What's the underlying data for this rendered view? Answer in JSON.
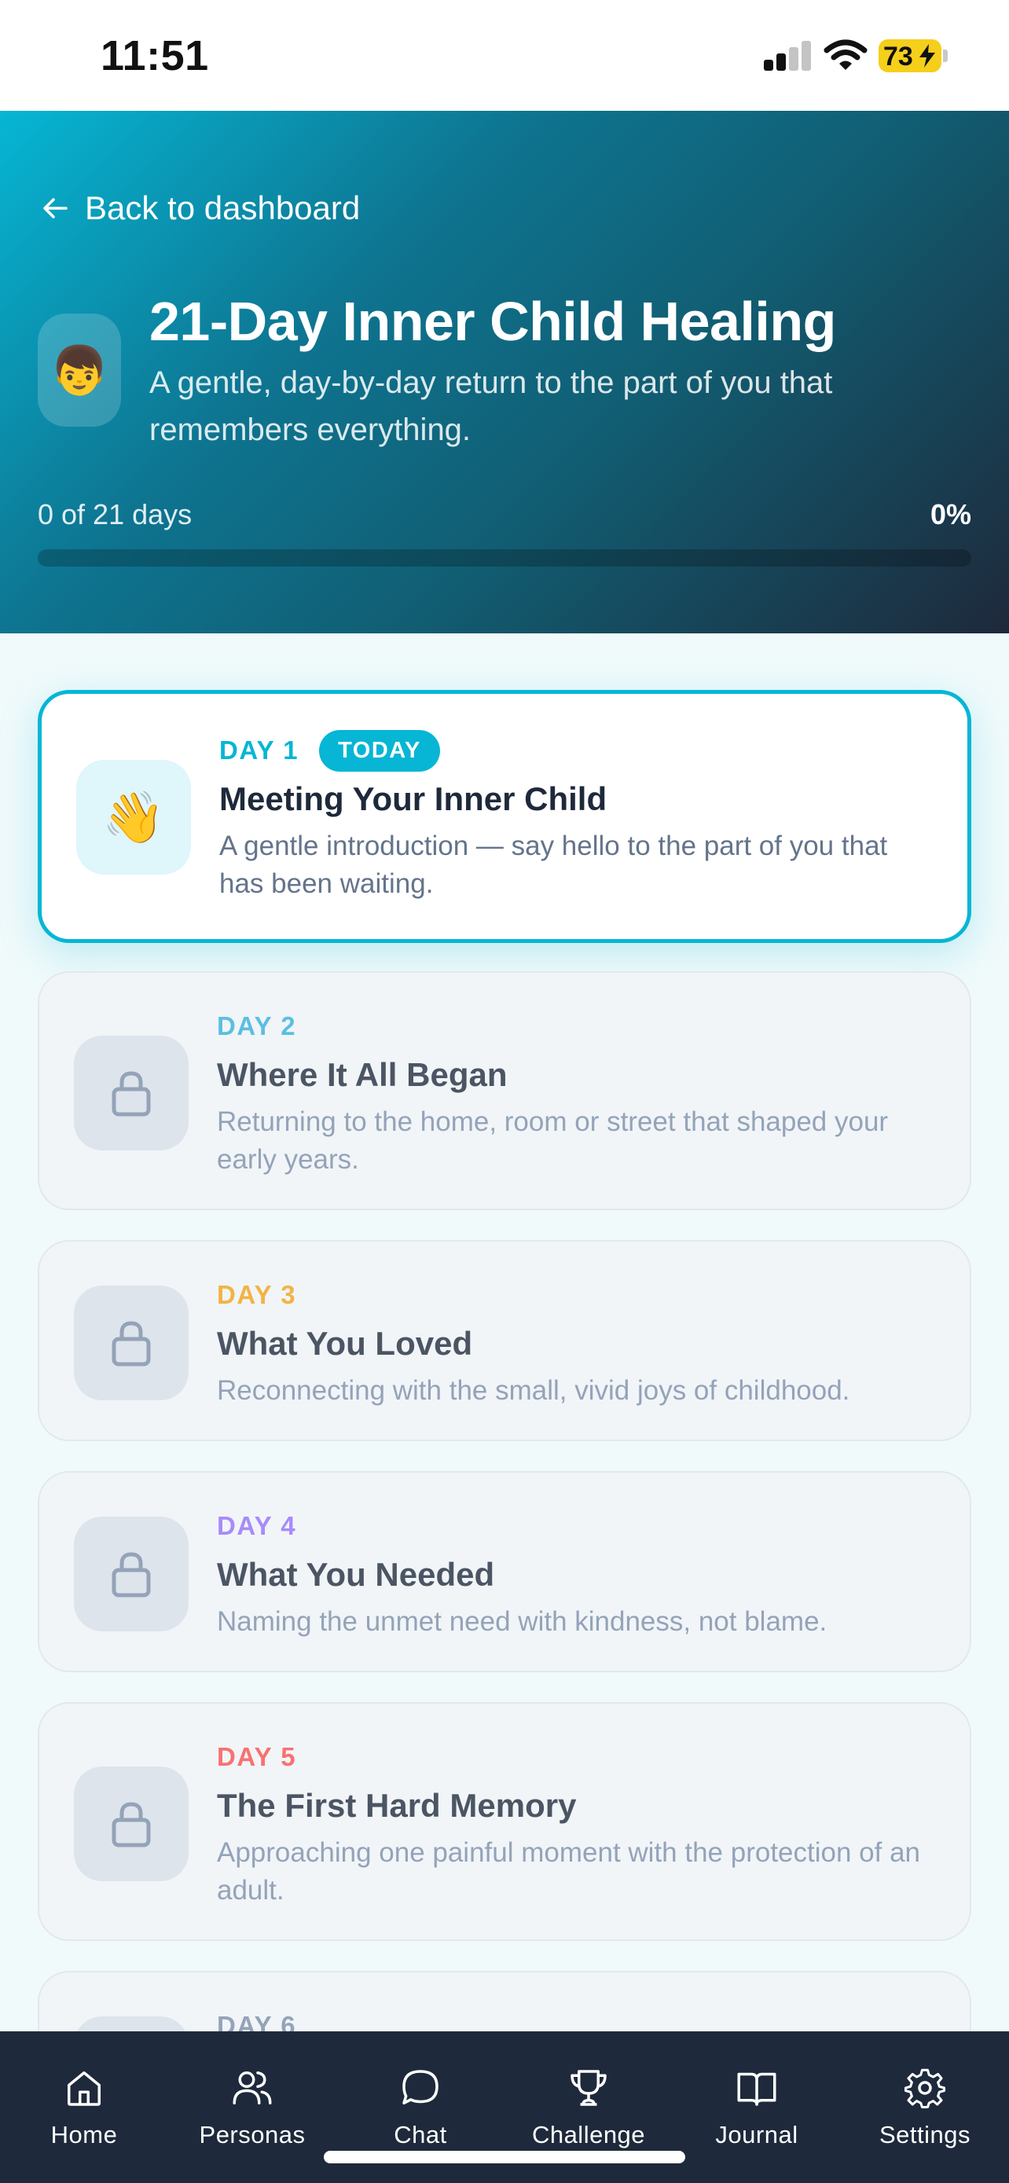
{
  "status_bar": {
    "time": "11:51",
    "battery": "73"
  },
  "header": {
    "back_label": "Back to dashboard",
    "hero_emoji": "👦",
    "title": "21-Day Inner Child Healing",
    "subtitle": "A gentle, day-by-day return to the part of you that remembers everything.",
    "progress_label": "0 of 21 days",
    "progress_percent": "0%",
    "progress_fraction": 0
  },
  "days": [
    {
      "day": "DAY 1",
      "badge": "TODAY",
      "title": "Meeting Your Inner Child",
      "description": "A gentle introduction — say hello to the part of you that has been waiting.",
      "icon": "👋",
      "locked": false,
      "color": "#06b6d4"
    },
    {
      "day": "DAY 2",
      "title": "Where It All Began",
      "description": "Returning to the home, room or street that shaped your early years.",
      "icon": "lock-icon",
      "locked": true,
      "color": "#5bbfe0"
    },
    {
      "day": "DAY 3",
      "title": "What You Loved",
      "description": "Reconnecting with the small, vivid joys of childhood.",
      "icon": "lock-icon",
      "locked": true,
      "color": "#f3b343"
    },
    {
      "day": "DAY 4",
      "title": "What You Needed",
      "description": "Naming the unmet need with kindness, not blame.",
      "icon": "lock-icon",
      "locked": true,
      "color": "#a78bfa"
    },
    {
      "day": "DAY 5",
      "title": "The First Hard Memory",
      "description": "Approaching one painful moment with the protection of an adult.",
      "icon": "lock-icon",
      "locked": true,
      "color": "#f87171"
    },
    {
      "day": "DAY 6",
      "locked": true,
      "color": "#94a3b8"
    }
  ],
  "nav": {
    "home": "Home",
    "personas": "Personas",
    "chat": "Chat",
    "challenge": "Challenge",
    "journal": "Journal",
    "settings": "Settings"
  }
}
